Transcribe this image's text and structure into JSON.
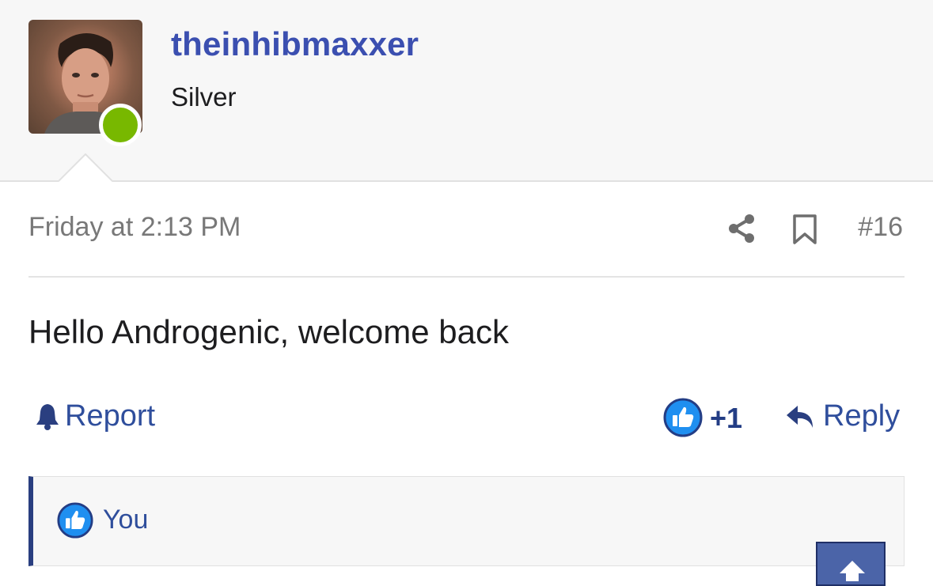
{
  "user": {
    "username": "theinhibmaxxer",
    "title": "Silver",
    "avatar_icon": "avatar-photo",
    "status": "online",
    "status_color": "#78b800"
  },
  "post": {
    "date": "Friday at 2:13 PM",
    "number": "#16",
    "body": "Hello Androgenic, welcome back"
  },
  "actions": {
    "report_label": "Report",
    "like_count": "+1",
    "reply_label": "Reply"
  },
  "reactions": {
    "user": "You",
    "icon": "thumbs-up-icon"
  },
  "colors": {
    "link": "#2f4e9c",
    "username": "#3b4fb0",
    "reaction_border": "#2a3f80"
  }
}
